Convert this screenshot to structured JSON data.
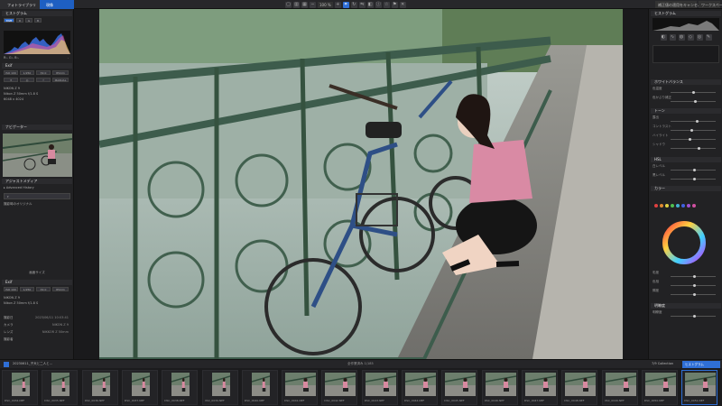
{
  "topbar": {
    "tab1": "フォトライブラリ",
    "tab2": "現像",
    "zoom": "100 %",
    "right1": "補正値の適用をキャンセル",
    "right2": "ワークスペース"
  },
  "left": {
    "panel_histogram": "ヒストグラム",
    "exif_label": "Exif",
    "exif_values": [
      "ISO 100",
      "1/250",
      "f/2.0",
      "85mm"
    ],
    "lens": "Nikon Z 50mm f/1.8 S",
    "lens_mode": "MANUAL",
    "camera": "NIKON Z 9",
    "size": "6048 x 4024",
    "panel_navigator": "ナビゲーター",
    "panel_adjust": "アジャストメディア",
    "advanced_history": "Advanced History",
    "history_item": "撮影時のオリジナル",
    "apply_all": "画面サイズ",
    "panel_exif2": "Exif",
    "info_rows": [
      {
        "label": "撮影日",
        "value": "2023/06/11 10:03:41"
      },
      {
        "label": "カメラ",
        "value": "NIKON Z 9"
      },
      {
        "label": "レンズ",
        "value": "NIKKOR Z 50mm"
      },
      {
        "label": "撮影者",
        "value": ""
      }
    ]
  },
  "right": {
    "panel_title": "ヒストグラム",
    "sections": [
      "ホワイトバランス",
      "トーン",
      "HSL",
      "カラー",
      "明瞭度"
    ],
    "rows": [
      "色温度",
      "色かぶり補正",
      "露出",
      "コントラスト",
      "ハイライト",
      "シャドウ",
      "白レベル",
      "黒レベル",
      "明瞭度",
      "彩度",
      "色相",
      "輝度"
    ]
  },
  "filmbar": {
    "left_label": "20230611_子犬と二人と...",
    "center_label": "全作業済み 1/185",
    "tag": "7/9 Collection",
    "sel_label": "ヒストグラム"
  },
  "filmstrip": [
    {
      "name": "DSC_0034.NEF"
    },
    {
      "name": "DSC_0035.NEF"
    },
    {
      "name": "DSC_0036.NEF"
    },
    {
      "name": "DSC_0037.NEF"
    },
    {
      "name": "DSC_0038.NEF"
    },
    {
      "name": "DSC_0039.NEF"
    },
    {
      "name": "DSC_0040.NEF"
    },
    {
      "name": "DSC_0041.NEF"
    },
    {
      "name": "DSC_0042.NEF"
    },
    {
      "name": "DSC_0043.NEF"
    },
    {
      "name": "DSC_0044.NEF"
    },
    {
      "name": "DSC_0045.NEF"
    },
    {
      "name": "DSC_0046.NEF"
    },
    {
      "name": "DSC_0047.NEF"
    },
    {
      "name": "DSC_0048.NEF"
    },
    {
      "name": "DSC_0049.NEF"
    },
    {
      "name": "DSC_0050.NEF"
    },
    {
      "name": "DSC_0051.NEF"
    }
  ]
}
